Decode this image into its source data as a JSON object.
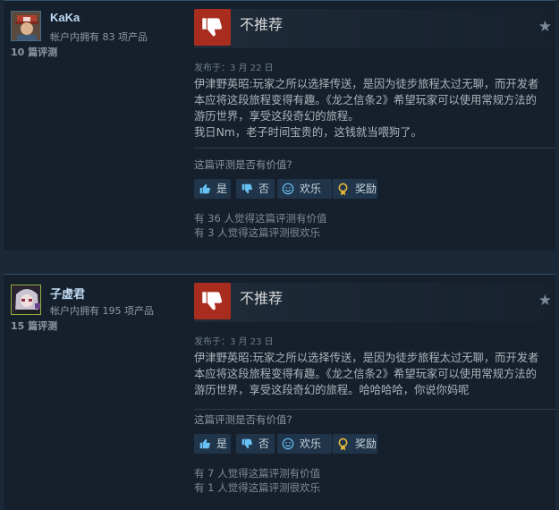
{
  "reviews": [
    {
      "user": {
        "name": "KaKa",
        "owned": "帐户内拥有 83 项产品",
        "review_count": "10 篇评测"
      },
      "vote": {
        "label": "不推荐",
        "icon": "thumbs-down-icon",
        "color": "#a82d1f"
      },
      "posted": "发布于：3 月 22 日",
      "content": "伊津野英昭:玩家之所以选择传送，是因为徒步旅程太过无聊，而开发者本应将这段旅程变得有趣。《龙之信条2》希望玩家可以使用常规方法的游历世界，享受这段奇幻的旅程。\n我日Nm，老子时间宝贵的，这钱就当喂狗了。",
      "helpful_question": "这篇评测是否有价值?",
      "buttons": {
        "yes": "是",
        "no": "否",
        "funny": "欢乐",
        "award": "奖励"
      },
      "helpful_count": "有 36 人觉得这篇评测有价值",
      "funny_count": "有 3 人觉得这篇评测很欢乐"
    },
    {
      "user": {
        "name": "子虚君",
        "owned": "帐户内拥有 195 项产品",
        "review_count": "15 篇评测"
      },
      "vote": {
        "label": "不推荐",
        "icon": "thumbs-down-icon",
        "color": "#a82d1f"
      },
      "posted": "发布于：3 月 23 日",
      "content": "伊津野英昭:玩家之所以选择传送，是因为徒步旅程太过无聊，而开发者本应将这段旅程变得有趣。《龙之信条2》希望玩家可以使用常规方法的游历世界，享受这段奇幻的旅程。哈哈哈哈，你说你妈呢",
      "helpful_question": "这篇评测是否有价值?",
      "buttons": {
        "yes": "是",
        "no": "否",
        "funny": "欢乐",
        "award": "奖励"
      },
      "helpful_count": "有 7 人觉得这篇评测有价值",
      "funny_count": "有 1 人觉得这篇评测很欢乐"
    }
  ]
}
